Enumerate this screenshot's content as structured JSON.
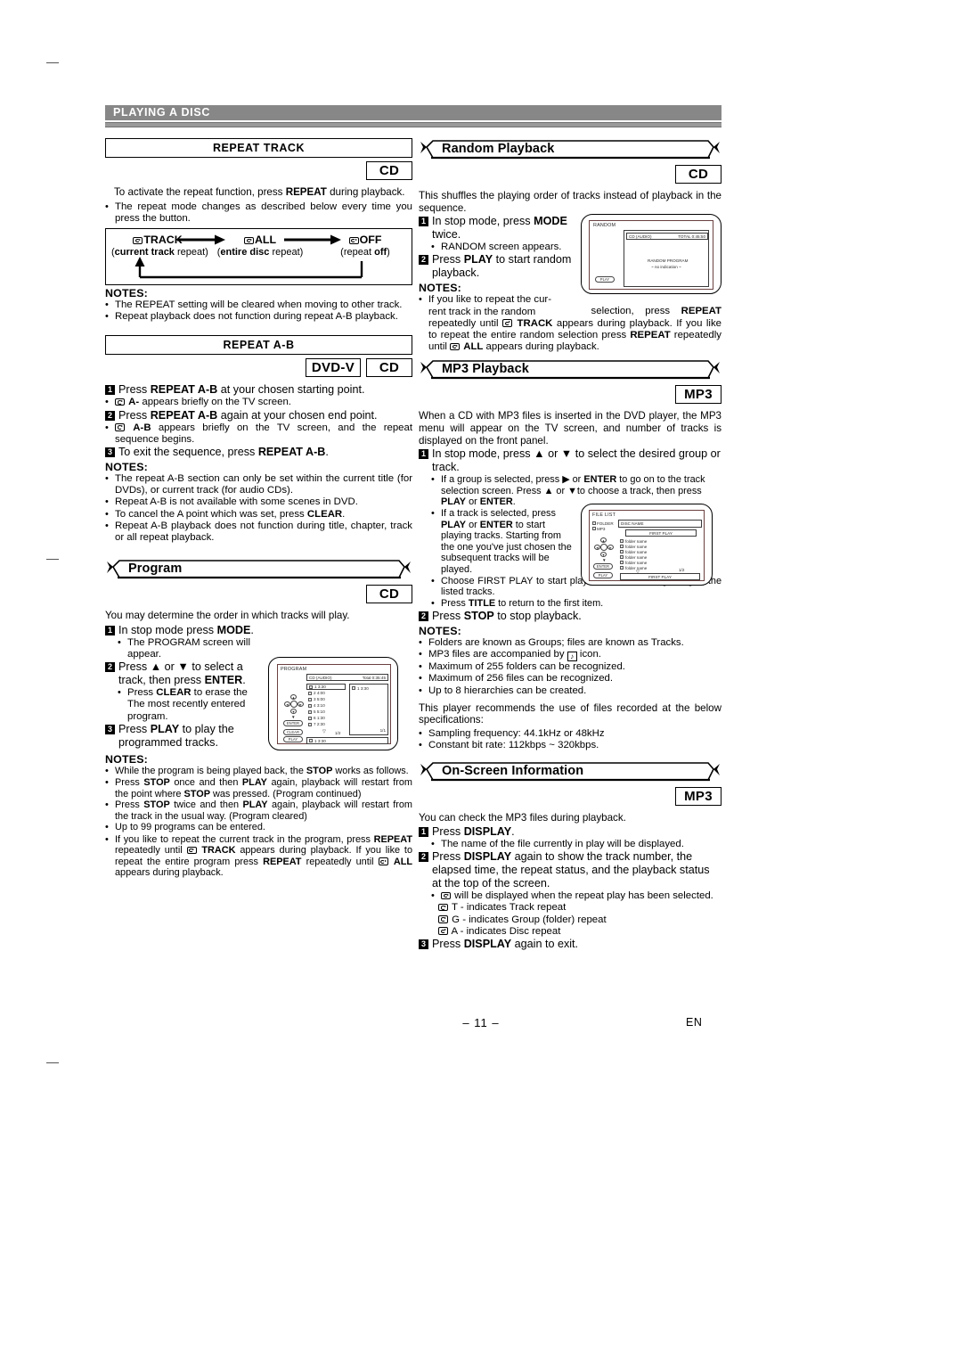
{
  "page": {
    "section_title": "PLAYING A DISC",
    "page_number": "– 11 –",
    "language_code": "EN"
  },
  "repeat_track": {
    "heading": "REPEAT TRACK",
    "badges": [
      "CD"
    ],
    "intro": "To activate the repeat function, press REPEAT during playback.",
    "intro_parts": {
      "a": "To activate the repeat function, press ",
      "b": "REPEAT",
      "c": " during playback."
    },
    "bullet1": {
      "a": "The repeat mode changes as described below every time you press the button."
    },
    "flow": {
      "items": [
        {
          "label": "TRACK",
          "sub_bold": "current track",
          "sub_rest": " repeat)",
          "sub_open": "("
        },
        {
          "label": "ALL",
          "sub_bold": "entire disc",
          "sub_rest": " repeat)",
          "sub_open": "("
        },
        {
          "label": "OFF",
          "sub_open": "(repeat ",
          "sub_bold": "off",
          "sub_rest": ")"
        }
      ]
    },
    "notes_heading": "NOTES:",
    "notes": [
      "The REPEAT setting will be cleared when moving to other track.",
      "Repeat playback does not function during repeat A-B playback."
    ]
  },
  "repeat_ab": {
    "heading": "REPEAT A-B",
    "badges": [
      "DVD-V",
      "CD"
    ],
    "steps": [
      {
        "num": "1",
        "a": "Press ",
        "b": "REPEAT A-B",
        "c": " at your chosen starting point."
      },
      {
        "num": "2",
        "a": "Press ",
        "b": "REPEAT A-B",
        "c": " again at your chosen end point."
      },
      {
        "num": "3",
        "a": "To exit the sequence, press ",
        "b": "REPEAT A-B",
        "c": "."
      }
    ],
    "bullet1": {
      "bold": "A-",
      "rest": " appears briefly on the TV screen."
    },
    "bullet2": {
      "bold": "A-B",
      "rest": " appears briefly on the TV screen, and the repeat sequence begins."
    },
    "notes_heading": "NOTES:",
    "notes": [
      "The repeat A-B section can only be set within the current title (for DVDs), or current track (for audio CDs).",
      "Repeat A-B is not available with some scenes in DVD.",
      "To cancel the A point which was set, press CLEAR.",
      "Repeat A-B playback does not function during title, chapter, track or all repeat playback."
    ]
  },
  "program": {
    "heading": "Program",
    "badges": [
      "CD"
    ],
    "intro": "You may determine the order in which tracks will play.",
    "steps": [
      {
        "num": "1",
        "a": "In stop mode press ",
        "b": "MODE",
        "c": "."
      },
      {
        "num": "2",
        "a": "Press ▲ or ▼ to select a track, then press ",
        "b": "ENTER",
        "c": "."
      },
      {
        "num": "3",
        "a": "Press ",
        "b": "PLAY",
        "c": " to play the programmed tracks."
      }
    ],
    "bullet1": "The PROGRAM screen will appear.",
    "bullet2": {
      "a": "Press ",
      "b": "CLEAR",
      "c": " to erase the The most recently entered program."
    },
    "notes_heading": "NOTES:",
    "notes": [
      "While the program is being played back, the STOP works as follows.",
      "Press STOP once and then PLAY again, playback will restart from the point where STOP was pressed. (Program continued)",
      "Press STOP twice and then PLAY again, playback will restart from the track in the usual way. (Program cleared)",
      "Up to 99 programs can be entered.",
      "If you like to repeat the current track in the program, press REPEAT repeatedly until TRACK appears during playback. If you like to repeat the entire program press REPEAT repeatedly until ALL appears during playback."
    ],
    "osd": {
      "title": "PROGRAM",
      "disc_label": "CD (AUDIO)",
      "total_label": "Total  0:35:45",
      "track_list": [
        "1   3:30",
        "2   4:00",
        "3   5:00",
        "4   3:10",
        "5   5:10",
        "6   1:30",
        "7   2:30"
      ],
      "program_list": [
        "1   3:30"
      ],
      "page_left": "1/2",
      "page_right": "1/1",
      "status_bar": "1   3:30",
      "buttons": [
        "ENTER",
        "CLEAR",
        "PLAY"
      ]
    }
  },
  "random_playback": {
    "heading": "Random Playback",
    "badges": [
      "CD"
    ],
    "intro": "This shuffles the playing order of tracks instead of playback in the sequence.",
    "steps": [
      {
        "num": "1",
        "a": "In stop mode, press ",
        "b": "MODE",
        "c": " twice."
      },
      {
        "num": "2",
        "a": "Press ",
        "b": "PLAY",
        "c": " to start random playback."
      }
    ],
    "bullet1": "RANDOM screen appears.",
    "notes_heading": "NOTES:",
    "notes": [
      "If you like to repeat the current track in the random selection, press REPEAT repeatedly until TRACK appears during playback. If you like to repeat the entire random selection press REPEAT repeatedly until ALL appears during playback."
    ],
    "osd": {
      "title": "RANDOM",
      "disc_label": "CD (AUDIO)",
      "total_label": "TOTAL 0:45:50",
      "line1": "RANDOM PROGRAM",
      "line2": "~ no indication ~",
      "buttons": [
        "PLAY"
      ]
    }
  },
  "mp3_playback": {
    "heading": "MP3 Playback",
    "badges": [
      "MP3"
    ],
    "intro": "When a CD with MP3 files is inserted in the DVD player, the MP3 menu will appear on the TV screen, and number of tracks is displayed on the front panel.",
    "steps": [
      {
        "num": "1",
        "a": "In stop mode, press ▲ or ▼ to select the desired group or track.",
        "b": "",
        "c": ""
      },
      {
        "num": "2",
        "a": "Press ",
        "b": "STOP",
        "c": " to stop playback."
      }
    ],
    "bullets": [
      {
        "a": "If a group is selected, press ▶ or ",
        "b": "ENTER",
        "c": " to go on to the track selection screen.  Press ▲ or ▼to choose a track, then press ",
        "d": "PLAY",
        "e": " or ",
        "f": "ENTER",
        "g": "."
      },
      {
        "a": "If a track is selected, press ",
        "b": "PLAY",
        "c": " or ",
        "d": "ENTER",
        "e": " to start playing tracks. Starting from the one you've just chosen the subsequent tracks will be played."
      },
      {
        "a": "Choose FIRST PLAY to start playback from the beginning of the listed tracks."
      },
      {
        "a": "Press ",
        "b": "TITLE",
        "c": " to return to the first item."
      }
    ],
    "notes_heading": "NOTES:",
    "notes": [
      "Folders are known as Groups; files are known as Tracks.",
      "MP3 files are accompanied by    icon.",
      "Maximum of 255 folders can be recognized.",
      "Maximum of 256 files can be recognized.",
      "Up to 8 hierarchies can be created."
    ],
    "spec_intro": "This player recommends the use of files recorded at the below specifications:",
    "specs": [
      "Sampling frequency: 44.1kHz or 48kHz",
      "Constant bit rate: 112kbps ~ 320kbps."
    ],
    "osd": {
      "title": "FILE LIST",
      "legend": [
        "FOLDER",
        "MP3"
      ],
      "disc_name": "DISC NAME",
      "first_play_top": "FIRST PLAY",
      "folders": [
        "folder name",
        "folder name",
        "folder name",
        "folder name",
        "folder name",
        "folder name"
      ],
      "page": "1/2",
      "first_play_bottom": "FIRST PLAY",
      "buttons": [
        "ENTER",
        "PLAY"
      ]
    }
  },
  "on_screen_info": {
    "heading": "On-Screen Information",
    "badges": [
      "MP3"
    ],
    "intro": "You can check the MP3 files during playback.",
    "steps": [
      {
        "num": "1",
        "a": "Press ",
        "b": "DISPLAY",
        "c": "."
      },
      {
        "num": "2",
        "a": "Press ",
        "b": "DISPLAY",
        "c": " again to show the track number, the elapsed time, the repeat status, and the playback status at the top of the screen."
      },
      {
        "num": "3",
        "a": "Press ",
        "b": "DISPLAY",
        "c": " again to exit."
      }
    ],
    "bullet1": "The name of the file currently in play will be displayed.",
    "bullet2": "will be displayed when the repeat play has been selected.",
    "icon_lines": [
      "T - indicates Track repeat",
      "G - indicates Group (folder) repeat",
      "A - indicates Disc repeat"
    ]
  },
  "colors": {
    "header_bar": "#878787",
    "header_text": "#ffffff",
    "text": "#000000",
    "osd_border": "#6b4040"
  }
}
